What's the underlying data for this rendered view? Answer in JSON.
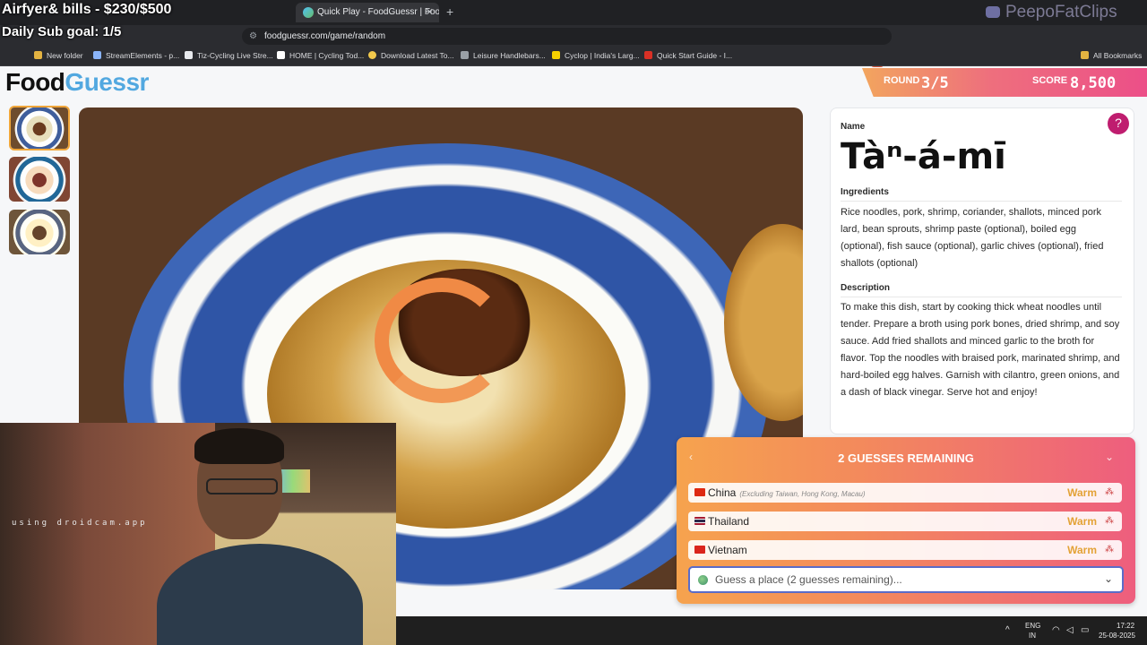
{
  "overlay": {
    "line1": "Airfyer& bills - $230/$500",
    "line2": "Daily Sub goal: 1/5",
    "watermark": "PeepoFatClips",
    "cam_text": "using droidcam.app"
  },
  "browser": {
    "tab_title": "Quick Play - FoodGuessr | FoodG",
    "url": "foodguessr.com/game/random",
    "bookmarks": [
      "New folder",
      "StreamElements - p...",
      "Tiz-Cycling Live Stre...",
      "HOME | Cycling Tod...",
      "Download Latest To...",
      "Leisure Handlebars...",
      "Cyclop | India's Larg...",
      "Quick Start Guide - I..."
    ],
    "all_bookmarks": "All Bookmarks"
  },
  "game": {
    "logo_a": "Food",
    "logo_b": "Guessr",
    "round_label": "ROUND",
    "round_value": "3/5",
    "score_label": "SCORE",
    "score_value": "8,500"
  },
  "dish": {
    "name_label": "Name",
    "name": "Tàⁿ-á-mī",
    "ingredients_label": "Ingredients",
    "ingredients": "Rice noodles, pork, shrimp, coriander, shallots, minced pork lard, bean sprouts, shrimp paste (optional), boiled egg (optional), fish sauce (optional), garlic chives (optional), fried shallots (optional)",
    "description_label": "Description",
    "description": "To make this dish, start by cooking thick wheat noodles until tender. Prepare a broth using pork bones, dried shrimp, and soy sauce. Add fried shallots and minced garlic to the broth for flavor. Top the noodles with braised pork, marinated shrimp, and hard-boiled egg halves. Garnish with cilantro, green onions, and a dash of black vinegar. Serve hot and enjoy!"
  },
  "guesses": {
    "title": "2 GUESSES REMAINING",
    "rows": [
      {
        "country": "China",
        "note": "(Excluding Taiwan, Hong Kong, Macau)",
        "result": "Warm",
        "flag_color": "#de2910"
      },
      {
        "country": "Thailand",
        "note": "",
        "result": "Warm",
        "flag_color": "#2d2a4a"
      },
      {
        "country": "Vietnam",
        "note": "",
        "result": "Warm",
        "flag_color": "#da251d"
      }
    ],
    "input_placeholder": "Guess a place (2 guesses remaining)..."
  },
  "taskbar": {
    "lang1": "ENG",
    "lang2": "IN",
    "time": "17:22",
    "date": "25-08-2025"
  }
}
